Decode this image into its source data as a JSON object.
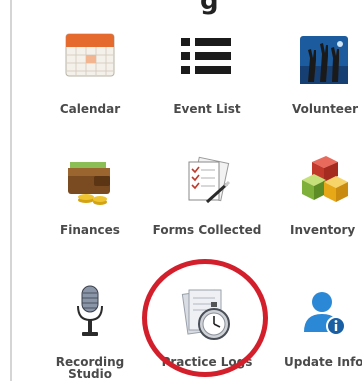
{
  "page": {
    "title_fragment": "g"
  },
  "tiles": [
    {
      "label": "Calendar",
      "icon": "calendar-icon"
    },
    {
      "label": "Event List",
      "icon": "list-icon"
    },
    {
      "label": "Volunteer",
      "icon": "volunteer-hands-icon"
    },
    {
      "label": "Finances",
      "icon": "wallet-coins-icon"
    },
    {
      "label": "Forms Collected",
      "icon": "forms-pen-icon"
    },
    {
      "label": "Inventory",
      "icon": "cubes-icon"
    },
    {
      "label": "Recording",
      "label2": "Studio",
      "icon": "microphone-icon"
    },
    {
      "label": "Practice Logs",
      "icon": "stopwatch-document-icon"
    },
    {
      "label": "Update Info",
      "icon": "user-info-icon"
    }
  ],
  "highlight": {
    "color": "#d21f2b",
    "target": "Practice Logs"
  }
}
